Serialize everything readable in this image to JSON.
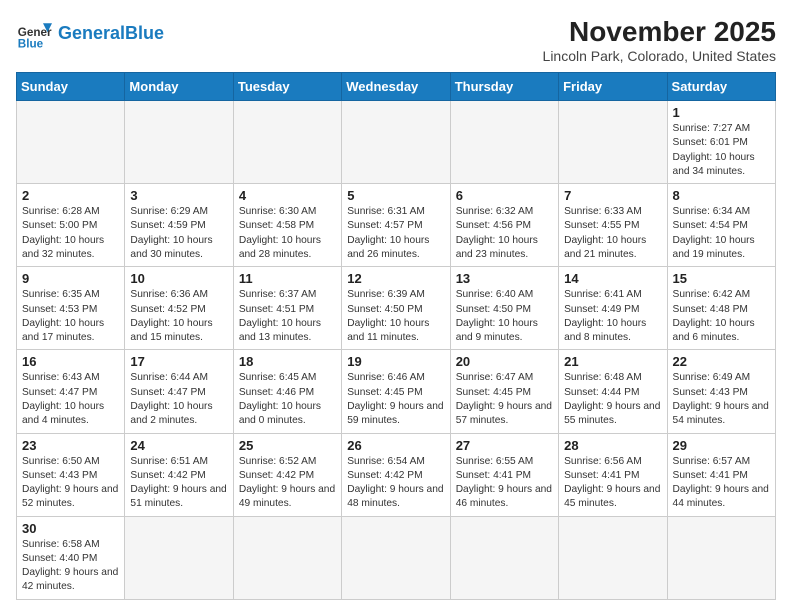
{
  "header": {
    "logo_general": "General",
    "logo_blue": "Blue",
    "month_title": "November 2025",
    "location": "Lincoln Park, Colorado, United States"
  },
  "days_of_week": [
    "Sunday",
    "Monday",
    "Tuesday",
    "Wednesday",
    "Thursday",
    "Friday",
    "Saturday"
  ],
  "weeks": [
    [
      {
        "day": "",
        "info": ""
      },
      {
        "day": "",
        "info": ""
      },
      {
        "day": "",
        "info": ""
      },
      {
        "day": "",
        "info": ""
      },
      {
        "day": "",
        "info": ""
      },
      {
        "day": "",
        "info": ""
      },
      {
        "day": "1",
        "info": "Sunrise: 7:27 AM\nSunset: 6:01 PM\nDaylight: 10 hours\nand 34 minutes."
      }
    ],
    [
      {
        "day": "2",
        "info": "Sunrise: 6:28 AM\nSunset: 5:00 PM\nDaylight: 10 hours\nand 32 minutes."
      },
      {
        "day": "3",
        "info": "Sunrise: 6:29 AM\nSunset: 4:59 PM\nDaylight: 10 hours\nand 30 minutes."
      },
      {
        "day": "4",
        "info": "Sunrise: 6:30 AM\nSunset: 4:58 PM\nDaylight: 10 hours\nand 28 minutes."
      },
      {
        "day": "5",
        "info": "Sunrise: 6:31 AM\nSunset: 4:57 PM\nDaylight: 10 hours\nand 26 minutes."
      },
      {
        "day": "6",
        "info": "Sunrise: 6:32 AM\nSunset: 4:56 PM\nDaylight: 10 hours\nand 23 minutes."
      },
      {
        "day": "7",
        "info": "Sunrise: 6:33 AM\nSunset: 4:55 PM\nDaylight: 10 hours\nand 21 minutes."
      },
      {
        "day": "8",
        "info": "Sunrise: 6:34 AM\nSunset: 4:54 PM\nDaylight: 10 hours\nand 19 minutes."
      }
    ],
    [
      {
        "day": "9",
        "info": "Sunrise: 6:35 AM\nSunset: 4:53 PM\nDaylight: 10 hours\nand 17 minutes."
      },
      {
        "day": "10",
        "info": "Sunrise: 6:36 AM\nSunset: 4:52 PM\nDaylight: 10 hours\nand 15 minutes."
      },
      {
        "day": "11",
        "info": "Sunrise: 6:37 AM\nSunset: 4:51 PM\nDaylight: 10 hours\nand 13 minutes."
      },
      {
        "day": "12",
        "info": "Sunrise: 6:39 AM\nSunset: 4:50 PM\nDaylight: 10 hours\nand 11 minutes."
      },
      {
        "day": "13",
        "info": "Sunrise: 6:40 AM\nSunset: 4:50 PM\nDaylight: 10 hours\nand 9 minutes."
      },
      {
        "day": "14",
        "info": "Sunrise: 6:41 AM\nSunset: 4:49 PM\nDaylight: 10 hours\nand 8 minutes."
      },
      {
        "day": "15",
        "info": "Sunrise: 6:42 AM\nSunset: 4:48 PM\nDaylight: 10 hours\nand 6 minutes."
      }
    ],
    [
      {
        "day": "16",
        "info": "Sunrise: 6:43 AM\nSunset: 4:47 PM\nDaylight: 10 hours\nand 4 minutes."
      },
      {
        "day": "17",
        "info": "Sunrise: 6:44 AM\nSunset: 4:47 PM\nDaylight: 10 hours\nand 2 minutes."
      },
      {
        "day": "18",
        "info": "Sunrise: 6:45 AM\nSunset: 4:46 PM\nDaylight: 10 hours\nand 0 minutes."
      },
      {
        "day": "19",
        "info": "Sunrise: 6:46 AM\nSunset: 4:45 PM\nDaylight: 9 hours\nand 59 minutes."
      },
      {
        "day": "20",
        "info": "Sunrise: 6:47 AM\nSunset: 4:45 PM\nDaylight: 9 hours\nand 57 minutes."
      },
      {
        "day": "21",
        "info": "Sunrise: 6:48 AM\nSunset: 4:44 PM\nDaylight: 9 hours\nand 55 minutes."
      },
      {
        "day": "22",
        "info": "Sunrise: 6:49 AM\nSunset: 4:43 PM\nDaylight: 9 hours\nand 54 minutes."
      }
    ],
    [
      {
        "day": "23",
        "info": "Sunrise: 6:50 AM\nSunset: 4:43 PM\nDaylight: 9 hours\nand 52 minutes."
      },
      {
        "day": "24",
        "info": "Sunrise: 6:51 AM\nSunset: 4:42 PM\nDaylight: 9 hours\nand 51 minutes."
      },
      {
        "day": "25",
        "info": "Sunrise: 6:52 AM\nSunset: 4:42 PM\nDaylight: 9 hours\nand 49 minutes."
      },
      {
        "day": "26",
        "info": "Sunrise: 6:54 AM\nSunset: 4:42 PM\nDaylight: 9 hours\nand 48 minutes."
      },
      {
        "day": "27",
        "info": "Sunrise: 6:55 AM\nSunset: 4:41 PM\nDaylight: 9 hours\nand 46 minutes."
      },
      {
        "day": "28",
        "info": "Sunrise: 6:56 AM\nSunset: 4:41 PM\nDaylight: 9 hours\nand 45 minutes."
      },
      {
        "day": "29",
        "info": "Sunrise: 6:57 AM\nSunset: 4:41 PM\nDaylight: 9 hours\nand 44 minutes."
      }
    ],
    [
      {
        "day": "30",
        "info": "Sunrise: 6:58 AM\nSunset: 4:40 PM\nDaylight: 9 hours\nand 42 minutes."
      },
      {
        "day": "",
        "info": ""
      },
      {
        "day": "",
        "info": ""
      },
      {
        "day": "",
        "info": ""
      },
      {
        "day": "",
        "info": ""
      },
      {
        "day": "",
        "info": ""
      },
      {
        "day": "",
        "info": ""
      }
    ]
  ]
}
